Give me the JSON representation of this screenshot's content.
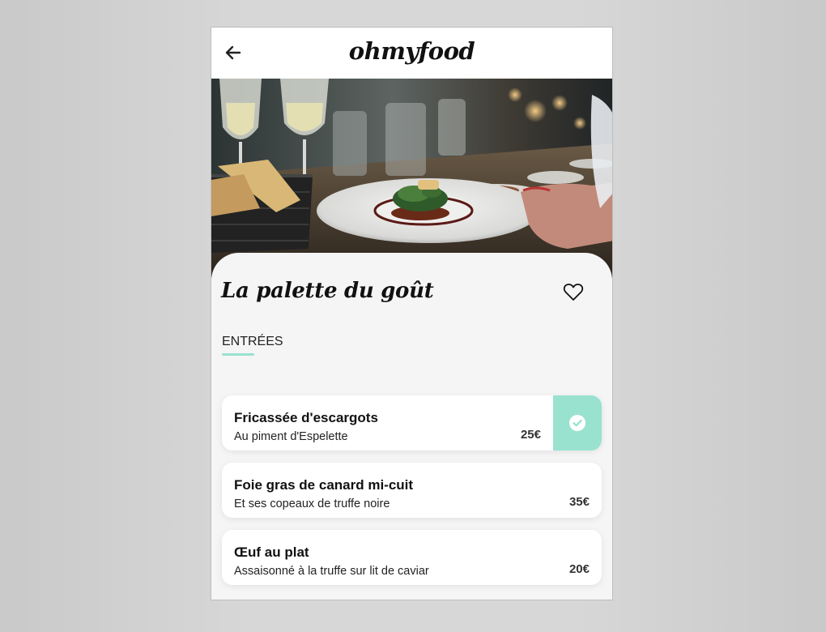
{
  "app": {
    "logo": "ohmyfood"
  },
  "colors": {
    "accent": "#99e2d0",
    "text": "#111111",
    "background": "#f5f5f5"
  },
  "header": {
    "back_icon": "arrow-left-icon"
  },
  "hero": {
    "image": "restaurant-table-plated-dish-photo"
  },
  "restaurant": {
    "name": "La palette du goût",
    "favorite_icon": "heart-outline-icon"
  },
  "menu": {
    "section_label": "ENTRÉES",
    "items": [
      {
        "name": "Fricassée d'escargots",
        "description": "Au piment d'Espelette",
        "price": "25€",
        "selected": true,
        "selected_icon": "check-circle-icon"
      },
      {
        "name": "Foie gras de canard mi-cuit",
        "description": "Et ses copeaux de truffe noire",
        "price": "35€",
        "selected": false
      },
      {
        "name": "Œuf au plat",
        "description": "Assaisonné à la truffe sur lit de caviar",
        "price": "20€",
        "selected": false
      }
    ]
  }
}
